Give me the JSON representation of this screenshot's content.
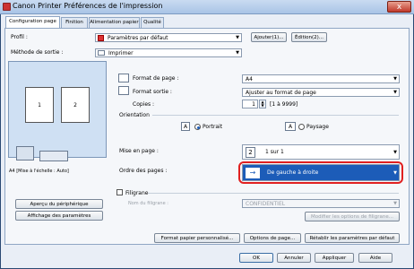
{
  "window": {
    "title": "Canon Printer Préférences de l'impression",
    "close_glyph": "x"
  },
  "tabs": [
    "Configuration page",
    "Finition",
    "Alimentation papier",
    "Qualité"
  ],
  "profile": {
    "label": "Profil :",
    "value": "Paramètres par défaut",
    "add_button": "Ajouter(1)...",
    "edit_button": "Édition(2)..."
  },
  "output": {
    "label": "Méthode de sortie :",
    "value": "Imprimer"
  },
  "preview": {
    "page_a": "1",
    "page_b": "2",
    "caption": "A4 [Mise à l'échelle : Auto]"
  },
  "left_buttons": {
    "device": "Aperçu du périphérique",
    "params": "Affichage des paramètres"
  },
  "form": {
    "page_format_label": "Format de page :",
    "page_format_value": "A4",
    "output_format_label": "Format sortie :",
    "output_format_value": "Ajuster au format de page",
    "copies_label": "Copies :",
    "copies_value": "1",
    "copies_range": "[1 à 9999]",
    "orientation_label": "Orientation",
    "portrait": "Portrait",
    "paysage": "Paysage",
    "layout_label": "Mise en page :",
    "layout_value": "1 sur 1",
    "layout_icon_text": "2",
    "order_label": "Ordre des pages :",
    "order_value": "De gauche à droite",
    "watermark_label": "Filigrane",
    "watermark_name_label": "Nom du filigrane :",
    "watermark_value": "CONFIDENTIEL",
    "watermark_button": "Modifier les options de filigrane..."
  },
  "bottom_buttons": {
    "custom_paper": "Format papier personnalisé...",
    "page_options": "Options de page...",
    "restore": "Rétablir les paramètres par défaut"
  },
  "dialog_buttons": {
    "ok": "OK",
    "cancel": "Annuler",
    "apply": "Appliquer",
    "help": "Aide"
  },
  "colors": {
    "highlight": "#1c5cb8",
    "red_outline": "#e02020"
  }
}
